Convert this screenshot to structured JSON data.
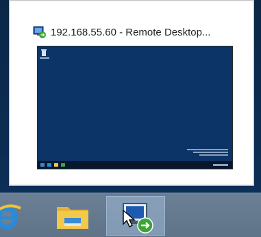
{
  "preview": {
    "title": "192.168.55.60 - Remote Desktop...",
    "icon": "remote-desktop-icon"
  },
  "taskbar": {
    "items": [
      {
        "name": "Internet Explorer",
        "icon": "ie-icon",
        "active": false
      },
      {
        "name": "File Explorer",
        "icon": "folder-icon",
        "active": false
      },
      {
        "name": "Remote Desktop Connection",
        "icon": "remote-desktop-icon",
        "active": true
      }
    ]
  },
  "colors": {
    "desktop": "#0c3466",
    "taskbar": "#647890",
    "ie_blue": "#2a8ad8",
    "folder_yellow": "#f3c94a"
  }
}
